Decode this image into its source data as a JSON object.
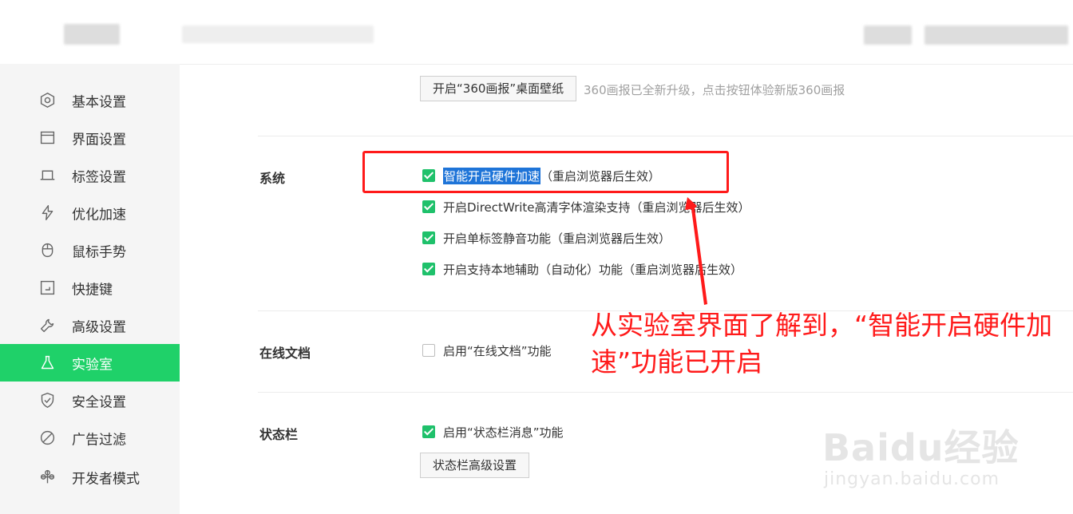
{
  "sidebar": {
    "items": [
      {
        "label": "基本设置",
        "icon": "hexagon-settings-icon",
        "active": false
      },
      {
        "label": "界面设置",
        "icon": "window-icon",
        "active": false
      },
      {
        "label": "标签设置",
        "icon": "tab-icon",
        "active": false
      },
      {
        "label": "优化加速",
        "icon": "lightning-icon",
        "active": false
      },
      {
        "label": "鼠标手势",
        "icon": "mouse-icon",
        "active": false
      },
      {
        "label": "快捷键",
        "icon": "keyboard-shortcut-icon",
        "active": false
      },
      {
        "label": "高级设置",
        "icon": "wrench-icon",
        "active": false
      },
      {
        "label": "实验室",
        "icon": "flask-icon",
        "active": true
      },
      {
        "label": "安全设置",
        "icon": "shield-icon",
        "active": false
      },
      {
        "label": "广告过滤",
        "icon": "block-icon",
        "active": false
      },
      {
        "label": "开发者模式",
        "icon": "developer-icon",
        "active": false
      }
    ],
    "accent_color": "#1fd169"
  },
  "main": {
    "wallpaper_button": "开启“360画报”桌面壁纸",
    "wallpaper_hint": "360画报已全新升级，点击按钮体验新版360画报",
    "system": {
      "title": "系统",
      "options": [
        {
          "label": "智能开启硬件加速",
          "note": "（重启浏览器后生效）",
          "checked": true,
          "highlighted": true
        },
        {
          "label": "开启DirectWrite高清字体渲染支持",
          "note": "（重启浏览器后生效）",
          "checked": true
        },
        {
          "label": "开启单标签静音功能",
          "note": "（重启浏览器后生效）",
          "checked": true
        },
        {
          "label": "开启支持本地辅助（自动化）功能",
          "note": "（重启浏览器后生效）",
          "checked": true
        }
      ]
    },
    "online_docs": {
      "title": "在线文档",
      "option": {
        "label": "启用“在线文档”功能",
        "checked": false
      }
    },
    "statusbar": {
      "title": "状态栏",
      "option": {
        "label": "启用“状态栏消息”功能",
        "checked": true
      },
      "button": "状态栏高级设置"
    }
  },
  "annotation": {
    "line1": "从实验室界面了解到，“智能开启硬件加",
    "line2": "速”功能已开启",
    "color": "#ff1a1a"
  },
  "watermark": {
    "logo": "Baidu经验",
    "url": "jingyan.baidu.com"
  }
}
